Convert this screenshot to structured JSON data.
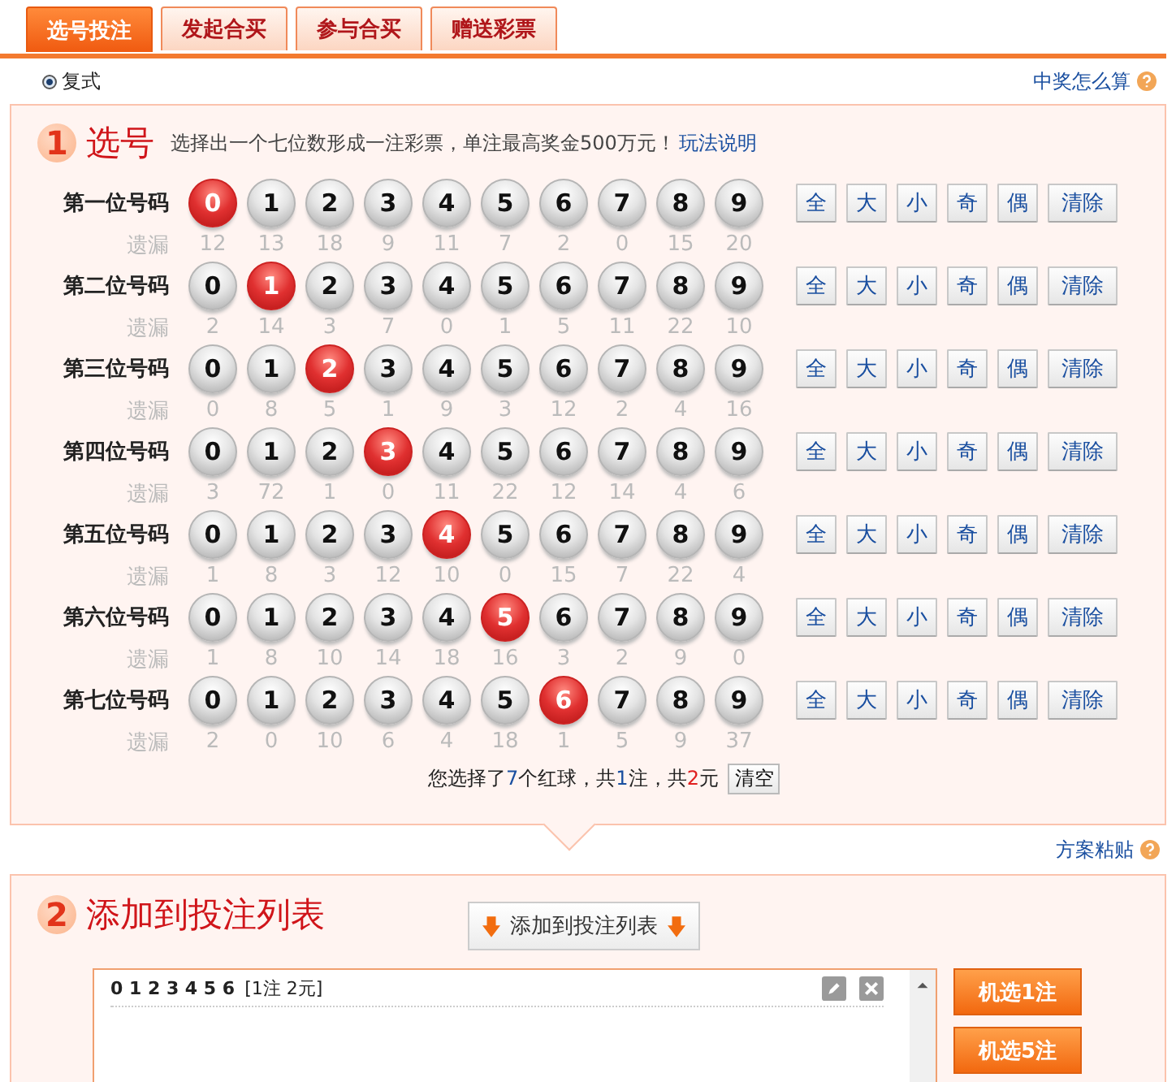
{
  "tabs": [
    {
      "label": "选号投注",
      "selected": true
    },
    {
      "label": "发起合买",
      "selected": false
    },
    {
      "label": "参与合买",
      "selected": false
    },
    {
      "label": "赠送彩票",
      "selected": false
    }
  ],
  "mode": {
    "label": "复式",
    "selected": true
  },
  "help_link": "中奖怎么算",
  "step1": {
    "number": "1",
    "title": "选号",
    "description": "选择出一个七位数形成一注彩票，单注最高奖金500万元！",
    "rules_link": "玩法说明",
    "rows": [
      {
        "label": "第一位号码",
        "miss_label": "遗漏",
        "balls": [
          {
            "n": "0",
            "selected": true,
            "miss": "12"
          },
          {
            "n": "1",
            "selected": false,
            "miss": "13"
          },
          {
            "n": "2",
            "selected": false,
            "miss": "18"
          },
          {
            "n": "3",
            "selected": false,
            "miss": "9"
          },
          {
            "n": "4",
            "selected": false,
            "miss": "11"
          },
          {
            "n": "5",
            "selected": false,
            "miss": "7"
          },
          {
            "n": "6",
            "selected": false,
            "miss": "2"
          },
          {
            "n": "7",
            "selected": false,
            "miss": "0"
          },
          {
            "n": "8",
            "selected": false,
            "miss": "15"
          },
          {
            "n": "9",
            "selected": false,
            "miss": "20"
          }
        ],
        "buttons": [
          "全",
          "大",
          "小",
          "奇",
          "偶",
          "清除"
        ]
      },
      {
        "label": "第二位号码",
        "miss_label": "遗漏",
        "balls": [
          {
            "n": "0",
            "selected": false,
            "miss": "2"
          },
          {
            "n": "1",
            "selected": true,
            "miss": "14"
          },
          {
            "n": "2",
            "selected": false,
            "miss": "3"
          },
          {
            "n": "3",
            "selected": false,
            "miss": "7"
          },
          {
            "n": "4",
            "selected": false,
            "miss": "0"
          },
          {
            "n": "5",
            "selected": false,
            "miss": "1"
          },
          {
            "n": "6",
            "selected": false,
            "miss": "5"
          },
          {
            "n": "7",
            "selected": false,
            "miss": "11"
          },
          {
            "n": "8",
            "selected": false,
            "miss": "22"
          },
          {
            "n": "9",
            "selected": false,
            "miss": "10"
          }
        ],
        "buttons": [
          "全",
          "大",
          "小",
          "奇",
          "偶",
          "清除"
        ]
      },
      {
        "label": "第三位号码",
        "miss_label": "遗漏",
        "balls": [
          {
            "n": "0",
            "selected": false,
            "miss": "0"
          },
          {
            "n": "1",
            "selected": false,
            "miss": "8"
          },
          {
            "n": "2",
            "selected": true,
            "miss": "5"
          },
          {
            "n": "3",
            "selected": false,
            "miss": "1"
          },
          {
            "n": "4",
            "selected": false,
            "miss": "9"
          },
          {
            "n": "5",
            "selected": false,
            "miss": "3"
          },
          {
            "n": "6",
            "selected": false,
            "miss": "12"
          },
          {
            "n": "7",
            "selected": false,
            "miss": "2"
          },
          {
            "n": "8",
            "selected": false,
            "miss": "4"
          },
          {
            "n": "9",
            "selected": false,
            "miss": "16"
          }
        ],
        "buttons": [
          "全",
          "大",
          "小",
          "奇",
          "偶",
          "清除"
        ]
      },
      {
        "label": "第四位号码",
        "miss_label": "遗漏",
        "balls": [
          {
            "n": "0",
            "selected": false,
            "miss": "3"
          },
          {
            "n": "1",
            "selected": false,
            "miss": "72"
          },
          {
            "n": "2",
            "selected": false,
            "miss": "1"
          },
          {
            "n": "3",
            "selected": true,
            "miss": "0"
          },
          {
            "n": "4",
            "selected": false,
            "miss": "11"
          },
          {
            "n": "5",
            "selected": false,
            "miss": "22"
          },
          {
            "n": "6",
            "selected": false,
            "miss": "12"
          },
          {
            "n": "7",
            "selected": false,
            "miss": "14"
          },
          {
            "n": "8",
            "selected": false,
            "miss": "4"
          },
          {
            "n": "9",
            "selected": false,
            "miss": "6"
          }
        ],
        "buttons": [
          "全",
          "大",
          "小",
          "奇",
          "偶",
          "清除"
        ]
      },
      {
        "label": "第五位号码",
        "miss_label": "遗漏",
        "balls": [
          {
            "n": "0",
            "selected": false,
            "miss": "1"
          },
          {
            "n": "1",
            "selected": false,
            "miss": "8"
          },
          {
            "n": "2",
            "selected": false,
            "miss": "3"
          },
          {
            "n": "3",
            "selected": false,
            "miss": "12"
          },
          {
            "n": "4",
            "selected": true,
            "miss": "10"
          },
          {
            "n": "5",
            "selected": false,
            "miss": "0"
          },
          {
            "n": "6",
            "selected": false,
            "miss": "15"
          },
          {
            "n": "7",
            "selected": false,
            "miss": "7"
          },
          {
            "n": "8",
            "selected": false,
            "miss": "22"
          },
          {
            "n": "9",
            "selected": false,
            "miss": "4"
          }
        ],
        "buttons": [
          "全",
          "大",
          "小",
          "奇",
          "偶",
          "清除"
        ]
      },
      {
        "label": "第六位号码",
        "miss_label": "遗漏",
        "balls": [
          {
            "n": "0",
            "selected": false,
            "miss": "1"
          },
          {
            "n": "1",
            "selected": false,
            "miss": "8"
          },
          {
            "n": "2",
            "selected": false,
            "miss": "10"
          },
          {
            "n": "3",
            "selected": false,
            "miss": "14"
          },
          {
            "n": "4",
            "selected": false,
            "miss": "18"
          },
          {
            "n": "5",
            "selected": true,
            "miss": "16"
          },
          {
            "n": "6",
            "selected": false,
            "miss": "3"
          },
          {
            "n": "7",
            "selected": false,
            "miss": "2"
          },
          {
            "n": "8",
            "selected": false,
            "miss": "9"
          },
          {
            "n": "9",
            "selected": false,
            "miss": "0"
          }
        ],
        "buttons": [
          "全",
          "大",
          "小",
          "奇",
          "偶",
          "清除"
        ]
      },
      {
        "label": "第七位号码",
        "miss_label": "遗漏",
        "balls": [
          {
            "n": "0",
            "selected": false,
            "miss": "2"
          },
          {
            "n": "1",
            "selected": false,
            "miss": "0"
          },
          {
            "n": "2",
            "selected": false,
            "miss": "10"
          },
          {
            "n": "3",
            "selected": false,
            "miss": "6"
          },
          {
            "n": "4",
            "selected": false,
            "miss": "4"
          },
          {
            "n": "5",
            "selected": false,
            "miss": "18"
          },
          {
            "n": "6",
            "selected": true,
            "miss": "1"
          },
          {
            "n": "7",
            "selected": false,
            "miss": "5"
          },
          {
            "n": "8",
            "selected": false,
            "miss": "9"
          },
          {
            "n": "9",
            "selected": false,
            "miss": "37"
          }
        ],
        "buttons": [
          "全",
          "大",
          "小",
          "奇",
          "偶",
          "清除"
        ]
      }
    ],
    "summary": [
      {
        "text": "您选择了"
      },
      {
        "text": "7",
        "color": "#1a4fa0"
      },
      {
        "text": "个红球，共"
      },
      {
        "text": "1",
        "color": "#1a4fa0"
      },
      {
        "text": "注，共"
      },
      {
        "text": "2",
        "color": "#e02020"
      },
      {
        "text": "元"
      }
    ],
    "clear_button": "清空"
  },
  "paste_link": "方案粘贴",
  "step2": {
    "number": "2",
    "title": "添加到投注列表",
    "add_button": "添加到投注列表",
    "entries": [
      {
        "numbers": "0 1 2 3 4 5 6",
        "detail": "[1注 2元]"
      }
    ],
    "random_buttons": [
      "机选1注",
      "机选5注"
    ]
  }
}
